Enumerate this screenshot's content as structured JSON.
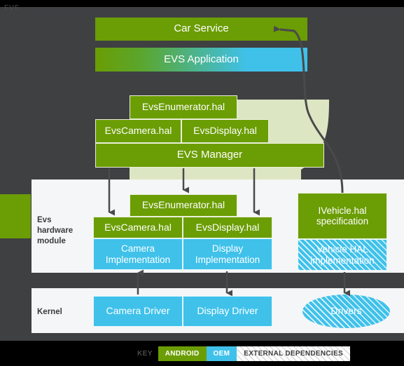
{
  "diagram": {
    "corner_text": "EVS",
    "app_layer": {
      "car_service": "Car Service",
      "evs_application": "EVS Application"
    },
    "manager_layer": {
      "evs_enumerator_hal": "EvsEnumerator.hal",
      "evs_camera_hal": "EvsCamera.hal",
      "evs_display_hal": "EvsDisplay.hal",
      "evs_manager": "EVS Manager"
    },
    "hardware_module": {
      "row_label": "Evs\nhardware\nmodule",
      "row_label_line1": "Evs",
      "row_label_line2": "hardware",
      "row_label_line3": "module",
      "evs_enumerator_hal": "EvsEnumerator.hal",
      "evs_camera_hal": "EvsCamera.hal",
      "evs_display_hal": "EvsDisplay.hal",
      "camera_implementation": "Camera\nImplementation",
      "camera_impl_line1": "Camera",
      "camera_impl_line2": "Implementation",
      "display_implementation": "Display\nImplementation",
      "display_impl_line1": "Display",
      "display_impl_line2": "Implementation",
      "ivehicle_hal_spec_line1": "IVehicle.hal",
      "ivehicle_hal_spec_line2": "specification",
      "vehicle_hal_impl_line1": "Vehicle HAL",
      "vehicle_hal_impl_line2": "implementation"
    },
    "kernel": {
      "row_label": "Kernel",
      "camera_driver": "Camera Driver",
      "display_driver": "Display Driver",
      "drivers": "Drivers"
    },
    "legend": {
      "key_label": "KEY",
      "android": "ANDROID",
      "oem": "OEM",
      "external": "EXTERNAL DEPENDENCIES"
    },
    "colors": {
      "android_green": "#6b9d04",
      "oem_blue": "#3fc1ea",
      "background_dark": "#3f4042",
      "panel_light": "#f5f6f7",
      "swoosh_light_green": "#dde6c3",
      "arrow_dark": "#4a4a4a",
      "black": "#000000"
    }
  }
}
